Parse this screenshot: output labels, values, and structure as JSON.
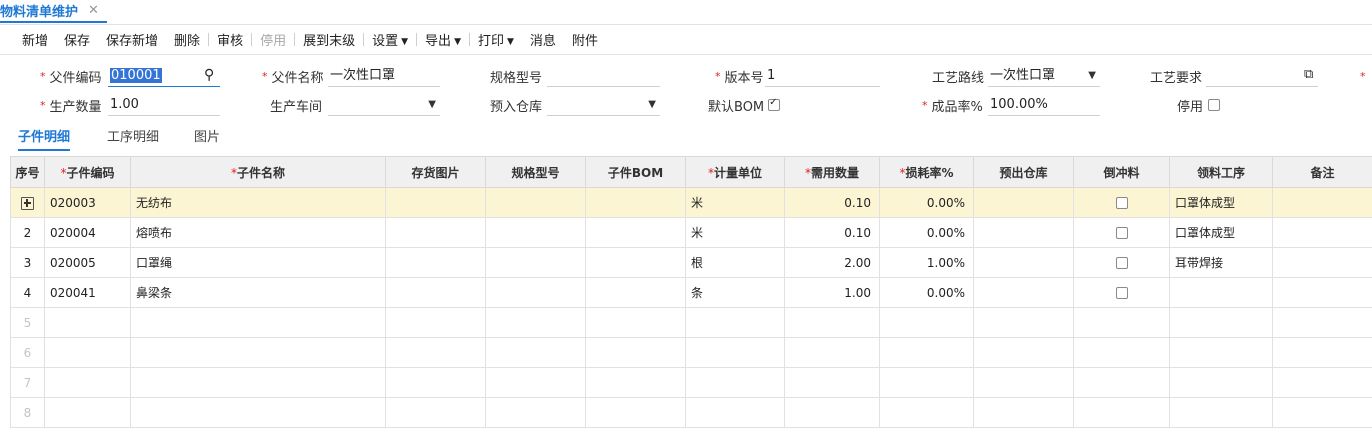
{
  "tab": {
    "title": "物料清单维护",
    "close": "✕"
  },
  "toolbar": {
    "new": "新增",
    "save": "保存",
    "save_new": "保存新增",
    "delete": "删除",
    "audit": "审核",
    "disable": "停用",
    "expand": "展到末级",
    "settings": "设置",
    "export": "导出",
    "print": "打印",
    "message": "消息",
    "attachment": "附件"
  },
  "form": {
    "parent_code": {
      "label": "父件编码",
      "value": "010001"
    },
    "parent_name": {
      "label": "父件名称",
      "value": "一次性口罩"
    },
    "spec": {
      "label": "规格型号",
      "value": ""
    },
    "version": {
      "label": "版本号",
      "value": "1"
    },
    "route": {
      "label": "工艺路线",
      "value": "一次性口罩"
    },
    "process_req": {
      "label": "工艺要求",
      "value": ""
    },
    "quantity": {
      "label": "生产数量",
      "value": "1.00"
    },
    "workshop": {
      "label": "生产车间",
      "value": ""
    },
    "warehouse": {
      "label": "预入仓库",
      "value": ""
    },
    "default_bom": {
      "label": "默认BOM",
      "checked": true
    },
    "yield": {
      "label": "成品率%",
      "value": "100.00%"
    },
    "disabled": {
      "label": "停用",
      "checked": false
    }
  },
  "detail_tabs": [
    "子件明细",
    "工序明细",
    "图片"
  ],
  "grid": {
    "headers": [
      "序号",
      "子件编码",
      "子件名称",
      "存货图片",
      "规格型号",
      "子件BOM",
      "计量单位",
      "需用数量",
      "损耗率%",
      "预出仓库",
      "倒冲料",
      "领料工序",
      "备注"
    ],
    "required": [
      "子件编码",
      "子件名称",
      "计量单位",
      "需用数量",
      "损耗率%"
    ],
    "rows": [
      {
        "seq": "",
        "code": "020003",
        "name": "无纺布",
        "unit": "米",
        "qty": "0.10",
        "loss": "0.00%",
        "backflush": false,
        "process": "口罩体成型",
        "selected": true
      },
      {
        "seq": "2",
        "code": "020004",
        "name": "熔喷布",
        "unit": "米",
        "qty": "0.10",
        "loss": "0.00%",
        "backflush": false,
        "process": "口罩体成型"
      },
      {
        "seq": "3",
        "code": "020005",
        "name": "口罩绳",
        "unit": "根",
        "qty": "2.00",
        "loss": "1.00%",
        "backflush": false,
        "process": "耳带焊接"
      },
      {
        "seq": "4",
        "code": "020041",
        "name": "鼻梁条",
        "unit": "条",
        "qty": "1.00",
        "loss": "0.00%",
        "backflush": false,
        "process": ""
      }
    ],
    "empty_rows": [
      "5",
      "6",
      "7",
      "8"
    ]
  }
}
